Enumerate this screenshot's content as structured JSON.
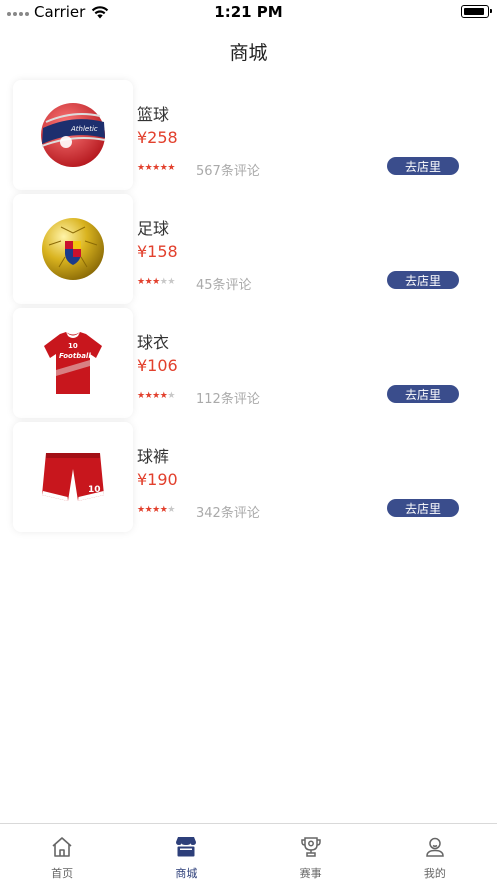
{
  "status_bar": {
    "carrier": "Carrier",
    "time": "1:21 PM"
  },
  "nav": {
    "title": "商城"
  },
  "products": [
    {
      "name": "篮球",
      "price": "¥258",
      "rating": 5,
      "reviews": "567条评论",
      "button": "去店里",
      "image": "basketball"
    },
    {
      "name": "足球",
      "price": "¥158",
      "rating": 3,
      "reviews": "45条评论",
      "button": "去店里",
      "image": "football"
    },
    {
      "name": "球衣",
      "price": "¥106",
      "rating": 4,
      "reviews": "112条评论",
      "button": "去店里",
      "image": "jersey"
    },
    {
      "name": "球裤",
      "price": "¥190",
      "rating": 4,
      "reviews": "342条评论",
      "button": "去店里",
      "image": "shorts"
    }
  ],
  "tabs": [
    {
      "label": "首页",
      "icon": "home-icon",
      "active": false
    },
    {
      "label": "商城",
      "icon": "store-icon",
      "active": true
    },
    {
      "label": "赛事",
      "icon": "trophy-icon",
      "active": false
    },
    {
      "label": "我的",
      "icon": "user-icon",
      "active": false
    }
  ],
  "colors": {
    "price": "#e2402d",
    "accent": "#3a4d8c",
    "active_tab": "#2d3f7a"
  }
}
